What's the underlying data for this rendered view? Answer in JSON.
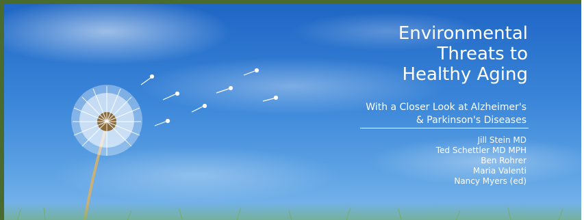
{
  "banner": {
    "title_lines": [
      "Environmental",
      "Threats to",
      "Healthy Aging"
    ],
    "subtitle_lines": [
      "With a Closer Look at Alzheimer's",
      "& Parkinson's Diseases"
    ],
    "authors": [
      "Jill Stein MD",
      "Ted Schettler MD MPH",
      "Ben Rohrer",
      "Maria Valenti",
      "Nancy Myers (ed)"
    ],
    "image_subject": "dandelion-against-blue-sky",
    "colors": {
      "frame": "#4a6b2f",
      "sky": "#2e78d2",
      "text": "#ffffff"
    }
  }
}
